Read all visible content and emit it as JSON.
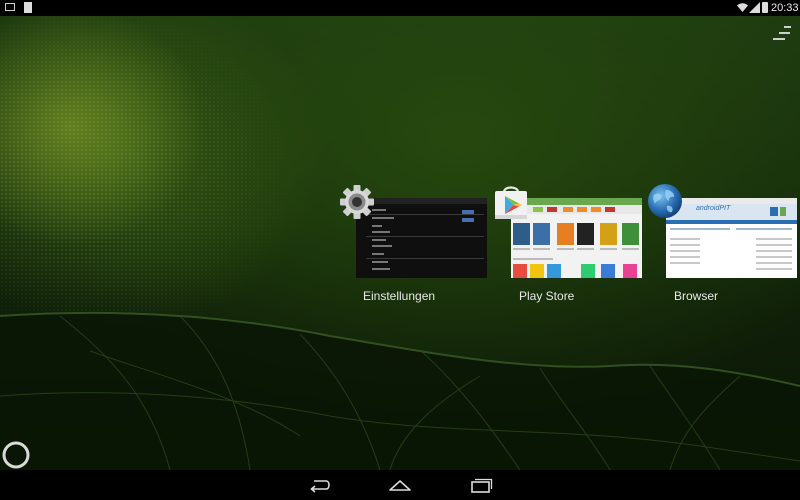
{
  "status_bar": {
    "time": "20:33",
    "icons": [
      "picture-notification-icon",
      "document-notification-icon",
      "wifi-icon",
      "signal-icon",
      "battery-icon"
    ]
  },
  "recents": {
    "apps": [
      {
        "name": "Einstellungen",
        "icon": "settings-gear-icon"
      },
      {
        "name": "Play Store",
        "icon": "play-store-icon"
      },
      {
        "name": "Browser",
        "icon": "globe-icon"
      }
    ],
    "browser_thumb_text": "androidPIT"
  },
  "navigation_bar": {
    "buttons": [
      "back-icon",
      "home-icon",
      "recent-apps-icon"
    ]
  },
  "colors": {
    "accent_green": "#5fb832",
    "play_orange": "#f08b2c",
    "browser_blue": "#2a6fb4"
  }
}
